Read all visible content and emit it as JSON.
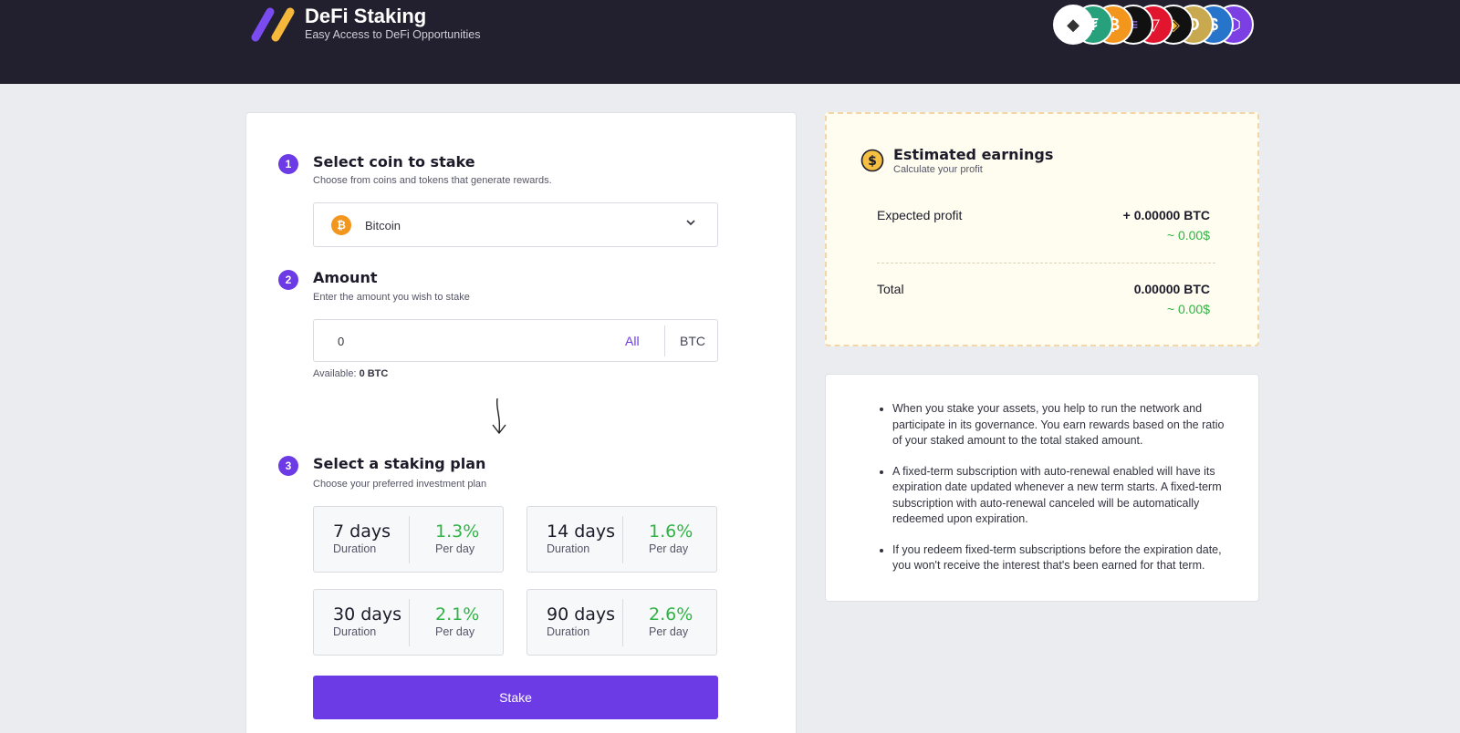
{
  "header": {
    "title": "DeFi Staking",
    "subtitle": "Easy Access to DeFi Opportunities",
    "coins": [
      {
        "icon": "ethereum-icon",
        "glyph": "◆",
        "color": "#ffffff",
        "fg": "#333333"
      },
      {
        "icon": "tether-icon",
        "glyph": "₮",
        "color": "#26a17b",
        "fg": "#ffffff"
      },
      {
        "icon": "bitcoin-icon",
        "glyph": "₿",
        "color": "#f2961e",
        "fg": "#ffffff"
      },
      {
        "icon": "solana-icon",
        "glyph": "≡",
        "color": "#111111",
        "fg": "#9b6cf5"
      },
      {
        "icon": "tron-icon",
        "glyph": "▽",
        "color": "#e2152f",
        "fg": "#ffffff"
      },
      {
        "icon": "bnb-icon",
        "glyph": "◈",
        "color": "#111111",
        "fg": "#f3ba2f"
      },
      {
        "icon": "dogecoin-icon",
        "glyph": "Ð",
        "color": "#c9a94f",
        "fg": "#ffffff"
      },
      {
        "icon": "usdc-icon",
        "glyph": "$",
        "color": "#2775ca",
        "fg": "#ffffff"
      },
      {
        "icon": "polygon-icon",
        "glyph": "⬡",
        "color": "#7b3fe4",
        "fg": "#ffffff"
      }
    ]
  },
  "step1": {
    "number": "1",
    "title": "Select coin to stake",
    "description": "Choose from coins and tokens that generate rewards.",
    "selected_coin": "Bitcoin",
    "coin_glyph": "₿"
  },
  "step2": {
    "number": "2",
    "title": "Amount",
    "description": "Enter the amount you wish to stake",
    "amount_value": "0",
    "all_label": "All",
    "currency": "BTC",
    "available_label": "Available:",
    "available_value": "0 BTC"
  },
  "step3": {
    "number": "3",
    "title": "Select a staking plan",
    "description": "Choose your preferred investment plan",
    "plans": [
      {
        "days": "7 days",
        "duration_label": "Duration",
        "rate": "1.3%",
        "rate_label": "Per day"
      },
      {
        "days": "14 days",
        "duration_label": "Duration",
        "rate": "1.6%",
        "rate_label": "Per day"
      },
      {
        "days": "30 days",
        "duration_label": "Duration",
        "rate": "2.1%",
        "rate_label": "Per day"
      },
      {
        "days": "90 days",
        "duration_label": "Duration",
        "rate": "2.6%",
        "rate_label": "Per day"
      }
    ]
  },
  "stake_button": "Stake",
  "earnings": {
    "title": "Estimated earnings",
    "subtitle": "Calculate your profit",
    "expected_label": "Expected profit",
    "expected_value": "+ 0.00000 BTC",
    "expected_usd": "~ 0.00$",
    "total_label": "Total",
    "total_value": "0.00000 BTC",
    "total_usd": "~ 0.00$"
  },
  "info": {
    "items": [
      "When you stake your assets, you help to run the network and participate in its governance. You earn rewards based on the ratio of your staked amount to the total staked amount.",
      "A fixed-term subscription with auto-renewal enabled will have its expiration date updated whenever a new term starts. A fixed-term subscription with auto-renewal canceled will be automatically redeemed upon expiration.",
      "If you redeem fixed-term subscriptions before the expiration date, you won't receive the interest that's been earned for that term."
    ]
  }
}
